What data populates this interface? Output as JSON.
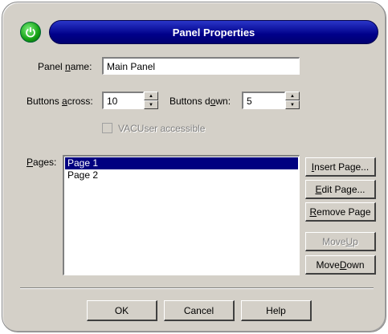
{
  "window": {
    "title": "Panel Properties"
  },
  "form": {
    "panel_name": {
      "label_pre": "Panel ",
      "label_u": "n",
      "label_post": "ame:",
      "value": "Main Panel"
    },
    "buttons_across": {
      "label_pre": "Buttons ",
      "label_u": "a",
      "label_post": "cross:",
      "value": "10"
    },
    "buttons_down": {
      "label_pre": "Buttons d",
      "label_u": "o",
      "label_post": "wn:",
      "value": "5"
    },
    "checkbox": {
      "label": "VACUser accessible",
      "checked": false,
      "enabled": false
    }
  },
  "pages": {
    "label_u": "P",
    "label_post": "ages:",
    "items": [
      "Page 1",
      "Page 2"
    ],
    "selected_index": 0
  },
  "side_buttons": [
    {
      "pre": "",
      "u": "I",
      "post": "nsert Page...",
      "enabled": true
    },
    {
      "pre": "",
      "u": "E",
      "post": "dit Page...",
      "enabled": true
    },
    {
      "pre": "",
      "u": "R",
      "post": "emove Page",
      "enabled": true
    },
    {
      "pre": "Move ",
      "u": "U",
      "post": "p",
      "enabled": false
    },
    {
      "pre": "Move ",
      "u": "D",
      "post": "own",
      "enabled": true
    }
  ],
  "footer": {
    "ok": "OK",
    "cancel": "Cancel",
    "help": "Help"
  },
  "colors": {
    "title_bar": "#00008a",
    "system_button": "#14a014",
    "selection": "#000080"
  }
}
